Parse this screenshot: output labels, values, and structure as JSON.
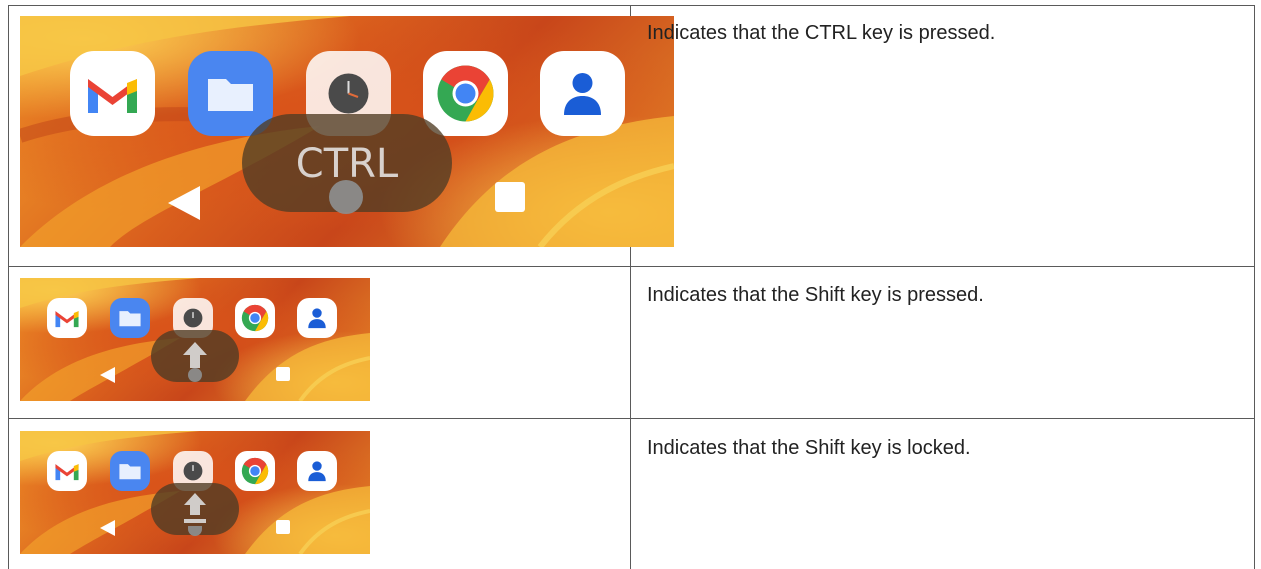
{
  "rows": [
    {
      "description": "Indicates that the CTRL key is pressed.",
      "indicator_label": "CTRL",
      "indicator_kind": "ctrl-pressed"
    },
    {
      "description": "Indicates that the Shift key is pressed.",
      "indicator_kind": "shift-pressed"
    },
    {
      "description": "Indicates that the Shift key is locked.",
      "indicator_kind": "shift-locked"
    }
  ],
  "dock_apps": [
    "gmail-icon",
    "files-icon",
    "clock-icon",
    "chrome-icon",
    "contacts-icon"
  ],
  "colors": {
    "gmail_red": "#ea4335",
    "gmail_blue": "#4285f4",
    "gmail_green": "#34a853",
    "gmail_yellow": "#fbbc04",
    "files_blue": "#4a86f0",
    "contacts_blue": "#1a5dd6",
    "indicator_bg": "#5a4326"
  }
}
